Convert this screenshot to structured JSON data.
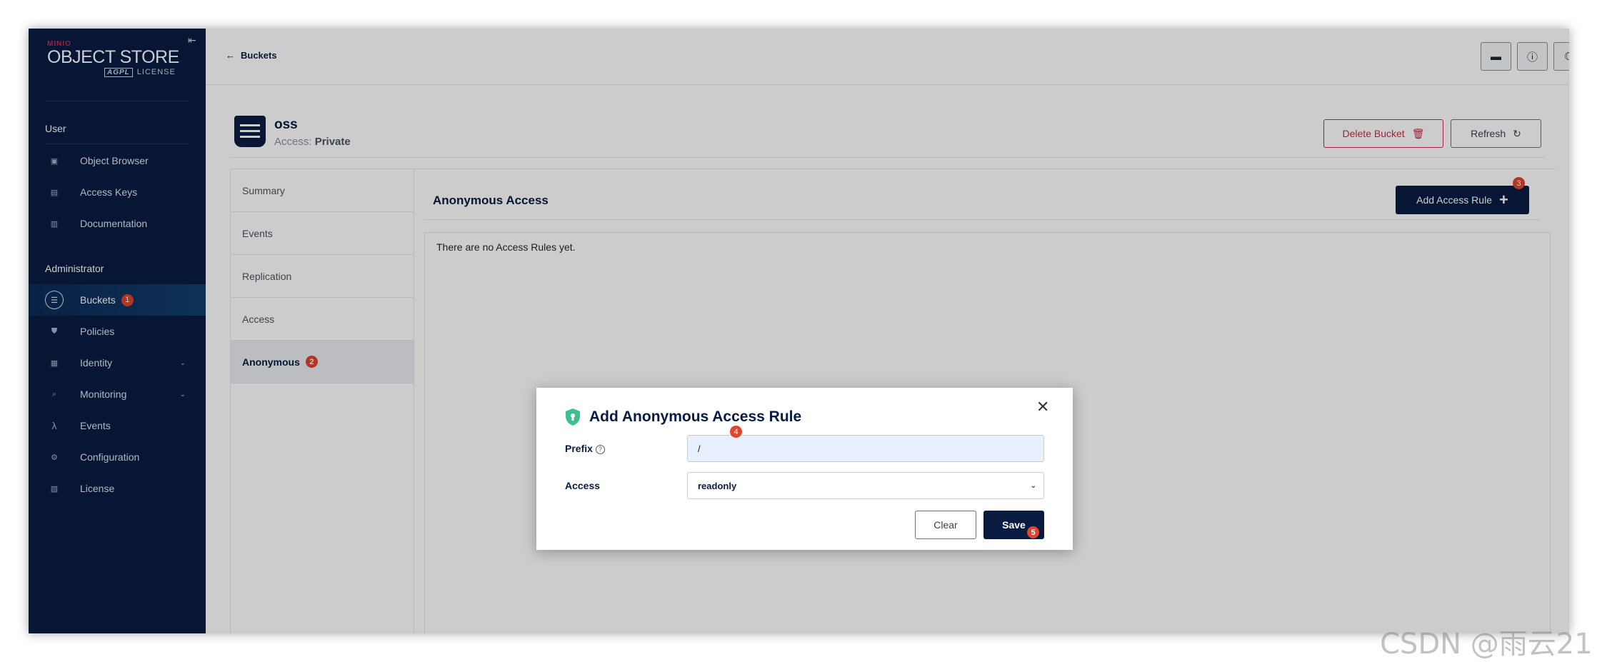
{
  "sidebar": {
    "brand_top": "MINIO",
    "brand_main": "OBJECT STORE",
    "brand_agpl": "AGPL",
    "brand_license": "LICENSE",
    "section_user": "User",
    "section_admin": "Administrator",
    "items": [
      {
        "label": "Object Browser",
        "icon": "object-browser-icon"
      },
      {
        "label": "Access Keys",
        "icon": "access-keys-icon"
      },
      {
        "label": "Documentation",
        "icon": "documentation-icon"
      },
      {
        "label": "Buckets",
        "icon": "buckets-icon",
        "badge": "1",
        "active": true
      },
      {
        "label": "Policies",
        "icon": "policies-icon"
      },
      {
        "label": "Identity",
        "icon": "identity-icon",
        "expandable": true
      },
      {
        "label": "Monitoring",
        "icon": "monitoring-icon",
        "expandable": true
      },
      {
        "label": "Events",
        "icon": "lambda-icon"
      },
      {
        "label": "Configuration",
        "icon": "gear-icon"
      },
      {
        "label": "License",
        "icon": "license-icon"
      }
    ]
  },
  "header": {
    "back_label": "Buckets"
  },
  "bucket": {
    "name": "oss",
    "access_label": "Access:",
    "access_value": "Private",
    "delete_label": "Delete Bucket",
    "refresh_label": "Refresh"
  },
  "tabs": [
    {
      "label": "Summary"
    },
    {
      "label": "Events"
    },
    {
      "label": "Replication"
    },
    {
      "label": "Access"
    },
    {
      "label": "Anonymous",
      "badge": "2",
      "active": true
    }
  ],
  "panel": {
    "title": "Anonymous Access",
    "add_rule_label": "Add Access Rule",
    "add_rule_badge": "3",
    "empty_text": "There are no Access Rules yet."
  },
  "modal": {
    "title": "Add Anonymous Access Rule",
    "prefix_label": "Prefix",
    "prefix_value": "/",
    "prefix_badge": "4",
    "access_label": "Access",
    "access_value": "readonly",
    "clear_label": "Clear",
    "save_label": "Save",
    "save_badge": "5"
  },
  "watermark": "CSDN @雨云21",
  "colors": {
    "sidebar_bg": "#081c42",
    "accent": "#081c42",
    "danger": "#c72c48",
    "badge": "#e0442c",
    "shield": "#3fbf8f"
  }
}
